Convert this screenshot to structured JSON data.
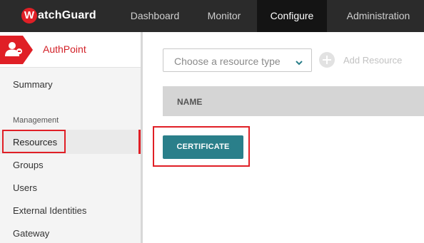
{
  "brand": {
    "logo_initial": "W",
    "logo_rest": "atchGuard",
    "accent_red": "#e01f26",
    "teal": "#2a7f8a"
  },
  "topnav": {
    "items": [
      {
        "label": "Dashboard",
        "active": false
      },
      {
        "label": "Monitor",
        "active": false
      },
      {
        "label": "Configure",
        "active": true
      },
      {
        "label": "Administration",
        "active": false
      }
    ]
  },
  "sidebar": {
    "header_icon": "user-group-icon",
    "title": "AuthPoint",
    "summary": "Summary",
    "section_label": "Management",
    "items": [
      {
        "label": "Resources",
        "selected": true
      },
      {
        "label": "Groups",
        "selected": false
      },
      {
        "label": "Users",
        "selected": false
      },
      {
        "label": "External Identities",
        "selected": false
      },
      {
        "label": "Gateway",
        "selected": false
      }
    ]
  },
  "main": {
    "resource_type_select": {
      "placeholder": "Choose a resource type",
      "icon": "chevron-down-icon"
    },
    "add_resource": {
      "label": "Add Resource",
      "icon": "plus-circle-icon"
    },
    "table": {
      "columns": [
        "NAME"
      ]
    },
    "certificate_button": "CERTIFICATE"
  }
}
